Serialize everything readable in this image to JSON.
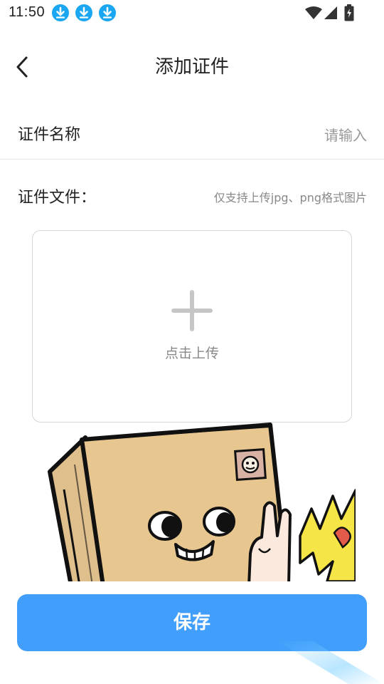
{
  "status_bar": {
    "time": "11:50",
    "left_icons": [
      "download-icon",
      "download-icon",
      "download-icon"
    ],
    "right_icons": [
      "wifi-icon",
      "signal-icon",
      "battery-charging-icon"
    ],
    "accent": "#1aa6f0"
  },
  "header": {
    "title": "添加证件",
    "back_icon": "chevron-left-icon"
  },
  "form": {
    "name_label": "证件名称",
    "name_value": "",
    "name_placeholder": "请输入",
    "file_label": "证件文件：",
    "file_hint": "仅支持上传jpg、png格式图片",
    "upload_icon": "plus-icon",
    "upload_text": "点击上传"
  },
  "illustration": {
    "icon": "cardboard-box-character-illustration"
  },
  "actions": {
    "save_label": "保存",
    "save_color": "#419ffb"
  }
}
